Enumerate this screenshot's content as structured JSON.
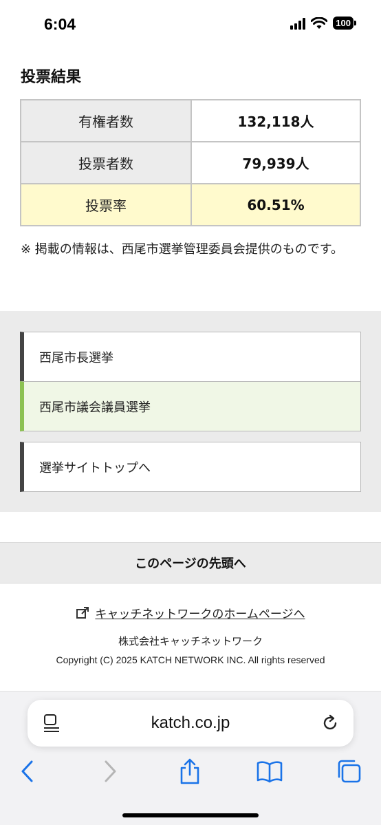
{
  "status_bar": {
    "time": "6:04",
    "battery": "100"
  },
  "results": {
    "title": "投票結果",
    "rows": [
      {
        "label": "有権者数",
        "value": "132,118人"
      },
      {
        "label": "投票者数",
        "value": "79,939人"
      },
      {
        "label": "投票率",
        "value": "60.51%"
      }
    ],
    "note": "※ 掲載の情報は、西尾市選挙管理委員会提供のものです。"
  },
  "nav": {
    "items": [
      {
        "label": "西尾市長選挙"
      },
      {
        "label": "西尾市議会議員選挙"
      },
      {
        "label": "選挙サイトトップへ"
      }
    ]
  },
  "page_top_label": "このページの先頭へ",
  "footer": {
    "link_text": "キャッチネットワークのホームページへ",
    "company": "株式会社キャッチネットワーク",
    "copyright": "Copyright (C) 2025 KATCH NETWORK INC. All rights reserved"
  },
  "browser": {
    "url": "katch.co.jp"
  },
  "colors": {
    "highlight_row": "#fffacd",
    "active_accent": "#8cc152",
    "link_blue": "#1a73e8"
  }
}
